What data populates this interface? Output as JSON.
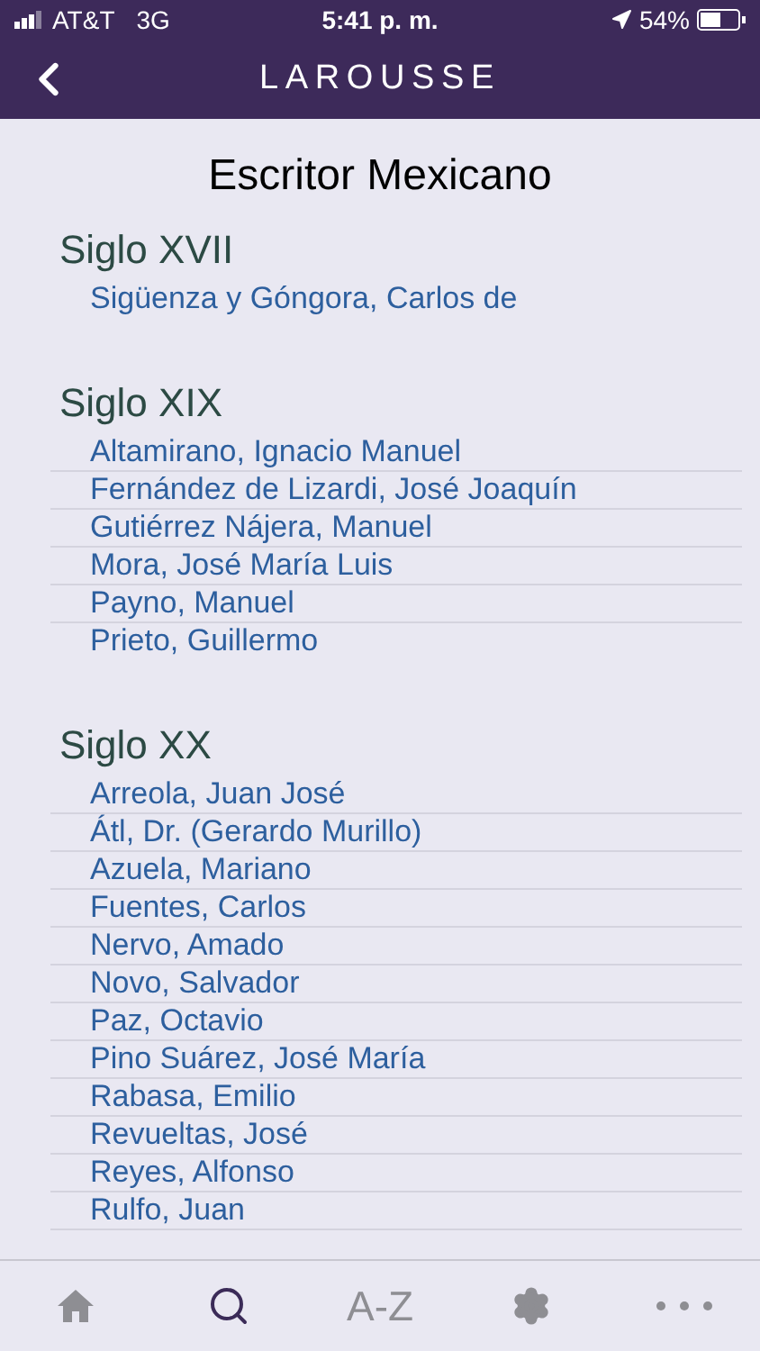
{
  "status_bar": {
    "carrier": "AT&T",
    "network": "3G",
    "time": "5:41 p. m.",
    "battery": "54%"
  },
  "nav": {
    "title": "LAROUSSE"
  },
  "page_title": "Escritor Mexicano",
  "sections": [
    {
      "heading": "Siglo XVII",
      "items": [
        "Sigüenza y Góngora, Carlos de"
      ]
    },
    {
      "heading": "Siglo XIX",
      "items": [
        "Altamirano, Ignacio Manuel",
        "Fernández de Lizardi, José Joaquín",
        "Gutiérrez Nájera, Manuel",
        "Mora, José María Luis",
        "Payno, Manuel",
        "Prieto, Guillermo"
      ]
    },
    {
      "heading": "Siglo XX",
      "items": [
        "Arreola, Juan José",
        "Átl, Dr. (Gerardo Murillo)",
        "Azuela, Mariano",
        "Fuentes, Carlos",
        "Nervo, Amado",
        "Novo, Salvador",
        "Paz, Octavio",
        "Pino Suárez, José María",
        "Rabasa, Emilio",
        "Revueltas, José",
        "Reyes, Alfonso",
        "Rulfo, Juan"
      ]
    }
  ],
  "tab_bar": [
    {
      "kind": "home",
      "selected": false
    },
    {
      "kind": "search",
      "selected": true
    },
    {
      "kind": "text",
      "label": "A-Z",
      "selected": false
    },
    {
      "kind": "settings",
      "selected": false
    },
    {
      "kind": "more",
      "selected": false
    }
  ]
}
